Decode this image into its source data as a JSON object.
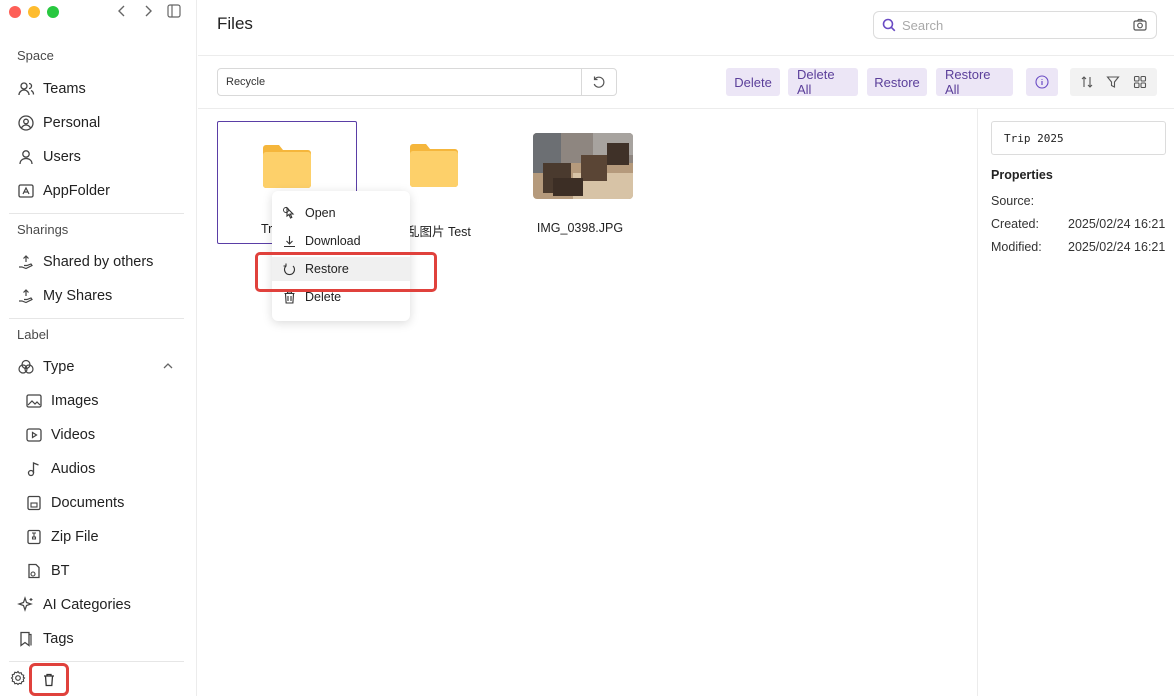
{
  "header": {
    "title": "Files",
    "search_placeholder": "Search"
  },
  "sidebar": {
    "section_space": "Space",
    "space_items": [
      "Teams",
      "Personal",
      "Users",
      "AppFolder"
    ],
    "section_sharings": "Sharings",
    "sharing_items": [
      "Shared by others",
      "My Shares"
    ],
    "section_label": "Label",
    "type_label": "Type",
    "type_items": [
      "Images",
      "Videos",
      "Audios",
      "Documents",
      "Zip File",
      "BT"
    ],
    "ai_categories": "AI Categories",
    "tags": "Tags"
  },
  "toolbar": {
    "path": "Recycle",
    "delete": "Delete",
    "delete_all": "Delete All",
    "restore": "Restore",
    "restore_all": "Restore All"
  },
  "files": [
    {
      "name": "Trip 2025",
      "visible_name": "Tr",
      "kind": "folder",
      "selected": true
    },
    {
      "name": "乱图片 Test",
      "kind": "folder"
    },
    {
      "name": "IMG_0398.JPG",
      "kind": "image"
    }
  ],
  "context_menu": {
    "items": [
      "Open",
      "Download",
      "Restore",
      "Delete"
    ],
    "highlighted": "Restore"
  },
  "properties": {
    "name_value": "Trip 2025",
    "title": "Properties",
    "source_label": "Source:",
    "source_value": "",
    "created_label": "Created:",
    "created_value": "2025/02/24 16:21",
    "modified_label": "Modified:",
    "modified_value": "2025/02/24 16:21"
  },
  "colors": {
    "accent": "#5b3f9a",
    "button_bg": "#ece6f6",
    "highlight_red": "#e0413c",
    "folder_yellow": "#fcc85a"
  }
}
